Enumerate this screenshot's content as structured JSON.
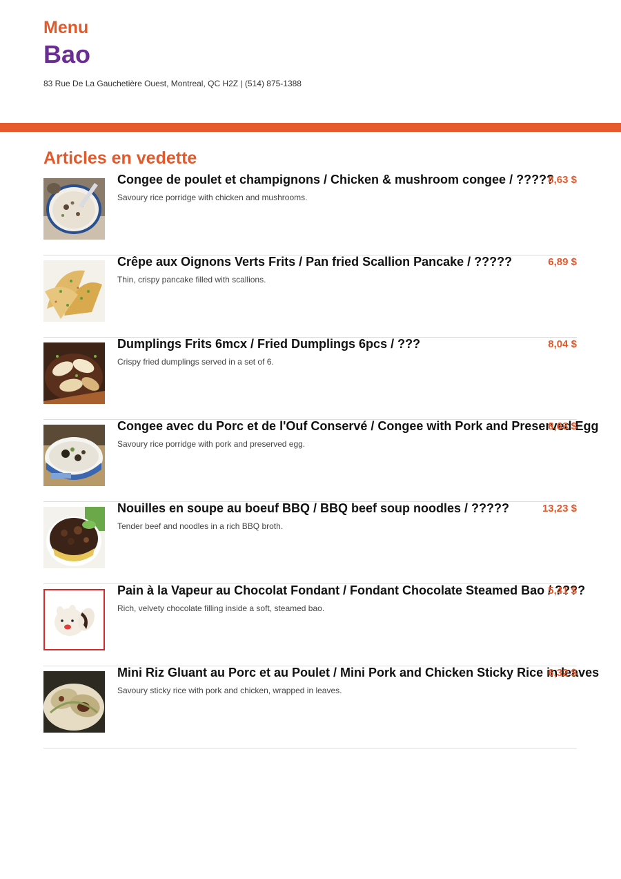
{
  "header": {
    "menu_label": "Menu",
    "restaurant_name": "Bao",
    "address": "83 Rue De La Gauchetière Ouest, Montreal, QC H2Z | (514) 875-1388"
  },
  "colors": {
    "accent": "#e25a2c",
    "brand": "#6a2d91",
    "divider": "#e75a2b"
  },
  "section": {
    "title": "Articles en vedette"
  },
  "items": [
    {
      "name": "Congee de poulet et champignons / Chicken & mushroom congee / ?????",
      "price": "8,63 $",
      "description": "Savoury rice porridge with chicken and mushrooms.",
      "image": "congee-bowl"
    },
    {
      "name": "Crêpe aux Oignons Verts Frits / Pan fried Scallion Pancake / ?????",
      "price": "6,89 $",
      "description": "Thin, crispy pancake filled with scallions.",
      "image": "scallion-pancake"
    },
    {
      "name": "Dumplings Frits 6mcx / Fried Dumplings 6pcs / ???",
      "price": "8,04 $",
      "description": "Crispy fried dumplings served in a set of 6.",
      "image": "fried-dumplings"
    },
    {
      "name": "Congee avec du Porc et de l'Ouf Conservé / Congee with Pork and Preserved Egg",
      "price": "8,63 $",
      "description": "Savoury rice porridge with pork and preserved egg.",
      "image": "pork-congee"
    },
    {
      "name": "Nouilles en soupe au boeuf BBQ / BBQ beef soup noodles / ?????",
      "price": "13,23 $",
      "description": "Tender beef and noodles in a rich BBQ broth.",
      "image": "beef-noodles"
    },
    {
      "name": "Pain à la Vapeur au Chocolat Fondant / Fondant Chocolate Steamed Bao / ????",
      "price": "5,41 $",
      "description": "Rich, velvety chocolate filling inside a soft, steamed bao.",
      "image": "chocolate-bao"
    },
    {
      "name": "Mini Riz Gluant au Porc et au Poulet / Mini Pork and Chicken Sticky Rice in leaves",
      "price": "6,32 $",
      "description": "Savoury sticky rice with pork and chicken, wrapped in leaves.",
      "image": "sticky-rice"
    }
  ]
}
